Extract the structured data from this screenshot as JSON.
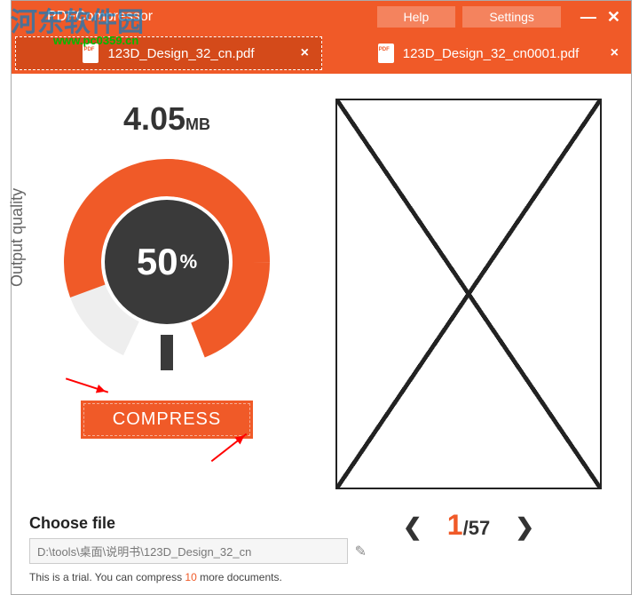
{
  "watermark": {
    "line1": "河东软件园",
    "line2": "www.pc0359.cn"
  },
  "titlebar": {
    "appname": "PDFCompressor",
    "help": "Help",
    "settings": "Settings"
  },
  "tabs": [
    {
      "file": "123D_Design_32_cn.pdf",
      "active": true
    },
    {
      "file": "123D_Design_32_cn0001.pdf",
      "active": false
    }
  ],
  "left": {
    "size_num": "4.05",
    "size_unit": "MB",
    "ylabel": "Output quality",
    "quality_pct": "50",
    "pct_sym": "%",
    "compress": "COMPRESS"
  },
  "pager": {
    "cur": "1",
    "sep": "/",
    "total": "57"
  },
  "footer": {
    "choose": "Choose file",
    "path": "D:\\tools\\桌面\\说明书\\123D_Design_32_cn",
    "trial_a": "This is a trial. You can compress ",
    "trial_n": "10",
    "trial_b": " more documents."
  }
}
